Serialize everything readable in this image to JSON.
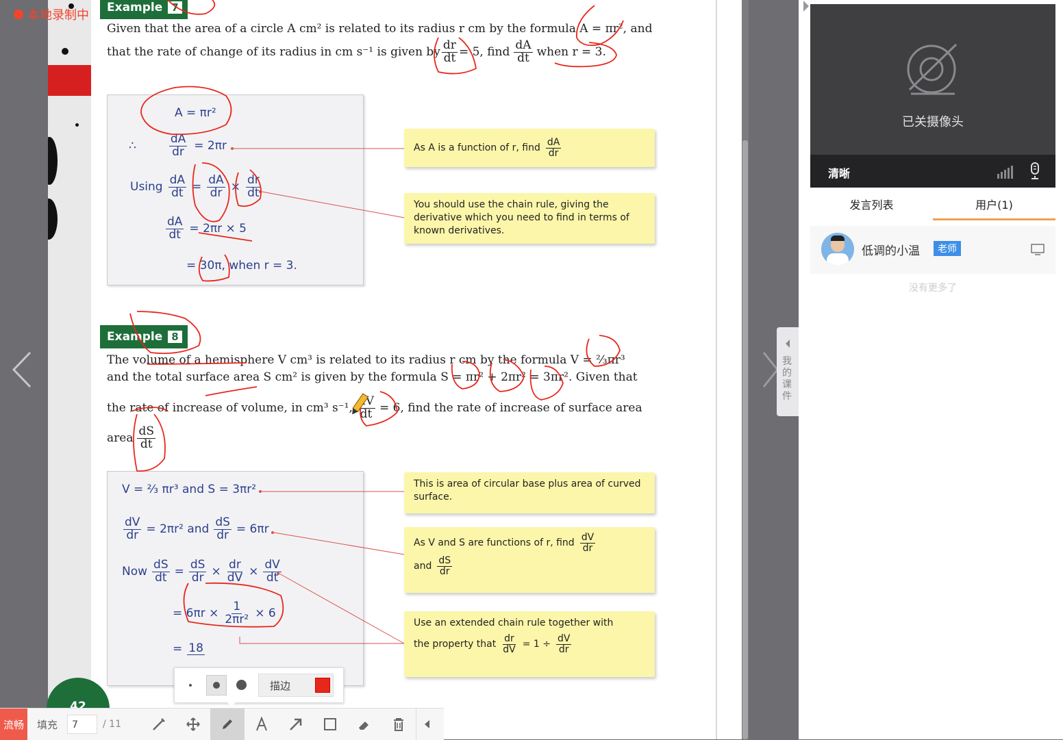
{
  "recording": {
    "status": "本地录制中"
  },
  "example7": {
    "badge": "Example",
    "number": "7",
    "line1": "Given that the area of a circle A cm² is related to its radius r cm by the formula A = πr², and",
    "line2_prefix": "that the rate of change of its radius in cm s⁻¹ is given by",
    "dr": "dr",
    "dt": "dt",
    "eq5": "= 5, find",
    "dA": "dA",
    "when": "when r = 3.",
    "work": {
      "l1": "A = πr²",
      "therefore": "∴",
      "l2_num": "dA",
      "l2_den": "dr",
      "l2_rhs": "= 2πr",
      "using": "Using",
      "l3a_num": "dA",
      "l3a_den": "dt",
      "l3b_num": "dA",
      "l3b_den": "dr",
      "l3c_num": "dr",
      "l3c_den": "dt",
      "l4_num": "dA",
      "l4_den": "dt",
      "l4_rhs": "= 2πr × 5",
      "l5": "= 30π, when r = 3."
    },
    "note1_text": "As A is a function of r, find",
    "note1_num": "dA",
    "note1_den": "dr",
    "note2": "You should use the chain rule, giving the derivative which you need to find in terms of known derivatives."
  },
  "example8": {
    "badge": "Example",
    "number": "8",
    "line1": "The volume of a hemisphere V cm³ is related to its radius r cm by the formula V = ⅔πr³",
    "line2": "and the total surface area S cm² is given by the formula S = πr² + 2πr² = 3πr². Given that",
    "line3_prefix": "the rate of increase of volume, in cm³ s⁻¹,",
    "dV": "dV",
    "dt": "dt",
    "line3_suffix": "= 6, find the rate of increase of surface area",
    "area": "area",
    "dS": "dS",
    "work": {
      "l1": "V = ⅔ πr³ and S = 3πr²",
      "l2a_num": "dV",
      "l2a_den": "dr",
      "l2a_rhs": "= 2πr² and",
      "l2b_num": "dS",
      "l2b_den": "dr",
      "l2b_rhs": "= 6πr",
      "now": "Now",
      "l3_num": "dS",
      "l3_den": "dt",
      "l3b_num": "dS",
      "l3b_den": "dr",
      "l3c_num": "dr",
      "l3c_den": "dV",
      "l3d_num": "dV",
      "l3d_den": "dt",
      "l4_pre": "= 6πr ×",
      "l4_num": "1",
      "l4_den": "2πr²",
      "l4_post": "× 6",
      "l5_pre": "=",
      "l5_num": "18"
    },
    "note1": "This is area of circular base plus area of curved surface.",
    "note2_text": "As V and S are functions of r, find",
    "note2_num": "dV",
    "note2_den": "dr",
    "note2_and": "and",
    "note2_num2": "dS",
    "note2_den2": "dr",
    "note3_line1": "Use an extended chain rule together with",
    "note3_prefix": "the property that",
    "note3_num": "dr",
    "note3_den": "dV",
    "note3_mid": "= 1 ÷",
    "note3_num2": "dV",
    "note3_den2": "dr"
  },
  "page_number": "42",
  "toolbar": {
    "quality": "流畅",
    "fill": "填充",
    "page_current": "7",
    "page_total": "/ 11",
    "stroke_label": "描边",
    "stroke_color": "#e8271c"
  },
  "camera": {
    "status": "已关摄像头",
    "quality": "清晰"
  },
  "tabs": {
    "speech": "发言列表",
    "users": "用户(1)"
  },
  "user": {
    "name": "低调的小温",
    "role": "老师"
  },
  "no_more": "没有更多了",
  "side_tab": "我的课件",
  "colors": {
    "accent": "#f0a050",
    "teacher_badge": "#3d8fe8",
    "example_green": "#1e6e3a",
    "annotation_red": "#e8271c",
    "note_yellow": "#fbf6a9"
  }
}
